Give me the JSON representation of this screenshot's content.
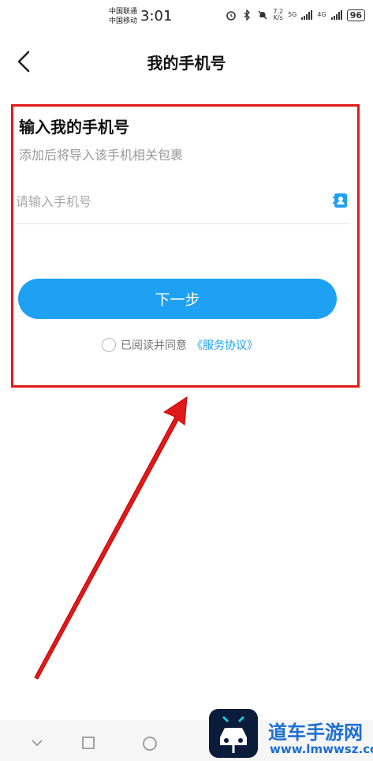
{
  "status_bar": {
    "carrier_1": "中国联通",
    "carrier_2": "中国移动",
    "time": "3:01",
    "speed_value": "7.2",
    "speed_unit": "K/s",
    "net_1": "5G",
    "net_2": "4G",
    "battery": "96"
  },
  "header": {
    "title": "我的手机号"
  },
  "form": {
    "heading": "输入我的手机号",
    "subheading": "添加后将导入该手机相关包裹",
    "phone_placeholder": "请输入手机号",
    "phone_value": "",
    "next_label": "下一步",
    "agree_text": "已阅读并同意",
    "agree_link": "《服务协议》"
  },
  "watermark": {
    "name": "道车手游网",
    "url": "www.lmwwsz.com"
  },
  "colors": {
    "accent": "#1ea1f2",
    "annotation": "#e01a1a"
  }
}
